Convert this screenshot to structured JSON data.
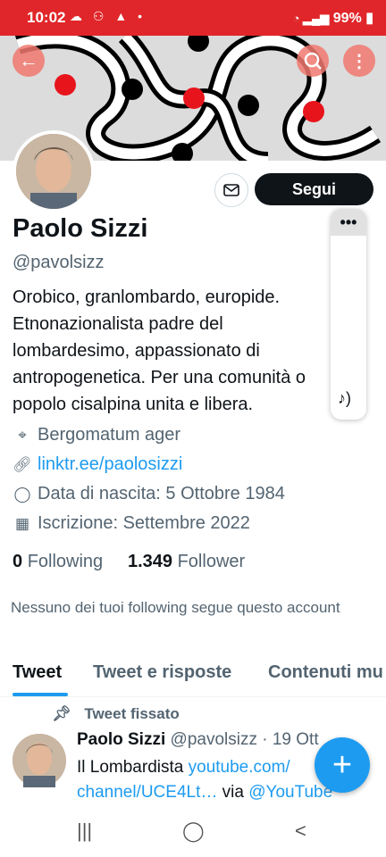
{
  "status_bar": {
    "time": "10:02",
    "battery": "99%"
  },
  "profile": {
    "name": "Paolo Sizzi",
    "handle": "@pavolsizz",
    "follow_label": "Segui",
    "bio_lines": [
      "Orobico, granlombardo, europide.",
      "Etnonazionalista padre del",
      "lombardesimo, appassionato di",
      "antropogenetica. Per una comunità o",
      "popolo cisalpina unita e libera."
    ],
    "location": "Bergomatum ager",
    "link": "linktr.ee/paolosizzi",
    "birth": "Data di nascita: 5 Ottobre 1984",
    "joined": "Iscrizione: Settembre 2022",
    "following_count": "0",
    "following_label": "Following",
    "followers_count": "1.349",
    "followers_label": "Follower",
    "notice": "Nessuno dei tuoi following segue questo account"
  },
  "tabs": [
    "Tweet",
    "Tweet e risposte",
    "Contenuti mu"
  ],
  "tweet": {
    "pinned_label": "Tweet fissato",
    "name": "Paolo Sizzi",
    "handle_time": "@pavolsizz · 19 Ott",
    "text_prefix": "Il Lombardista ",
    "link1": "youtube.com/",
    "link2": "channel/UCE4Lt…",
    "via": " via ",
    "via_handle": "@YouTube"
  },
  "colors": {
    "status_bar": "#e0262a",
    "accent": "#1d9bf0",
    "banner_red": "#e8141c"
  }
}
